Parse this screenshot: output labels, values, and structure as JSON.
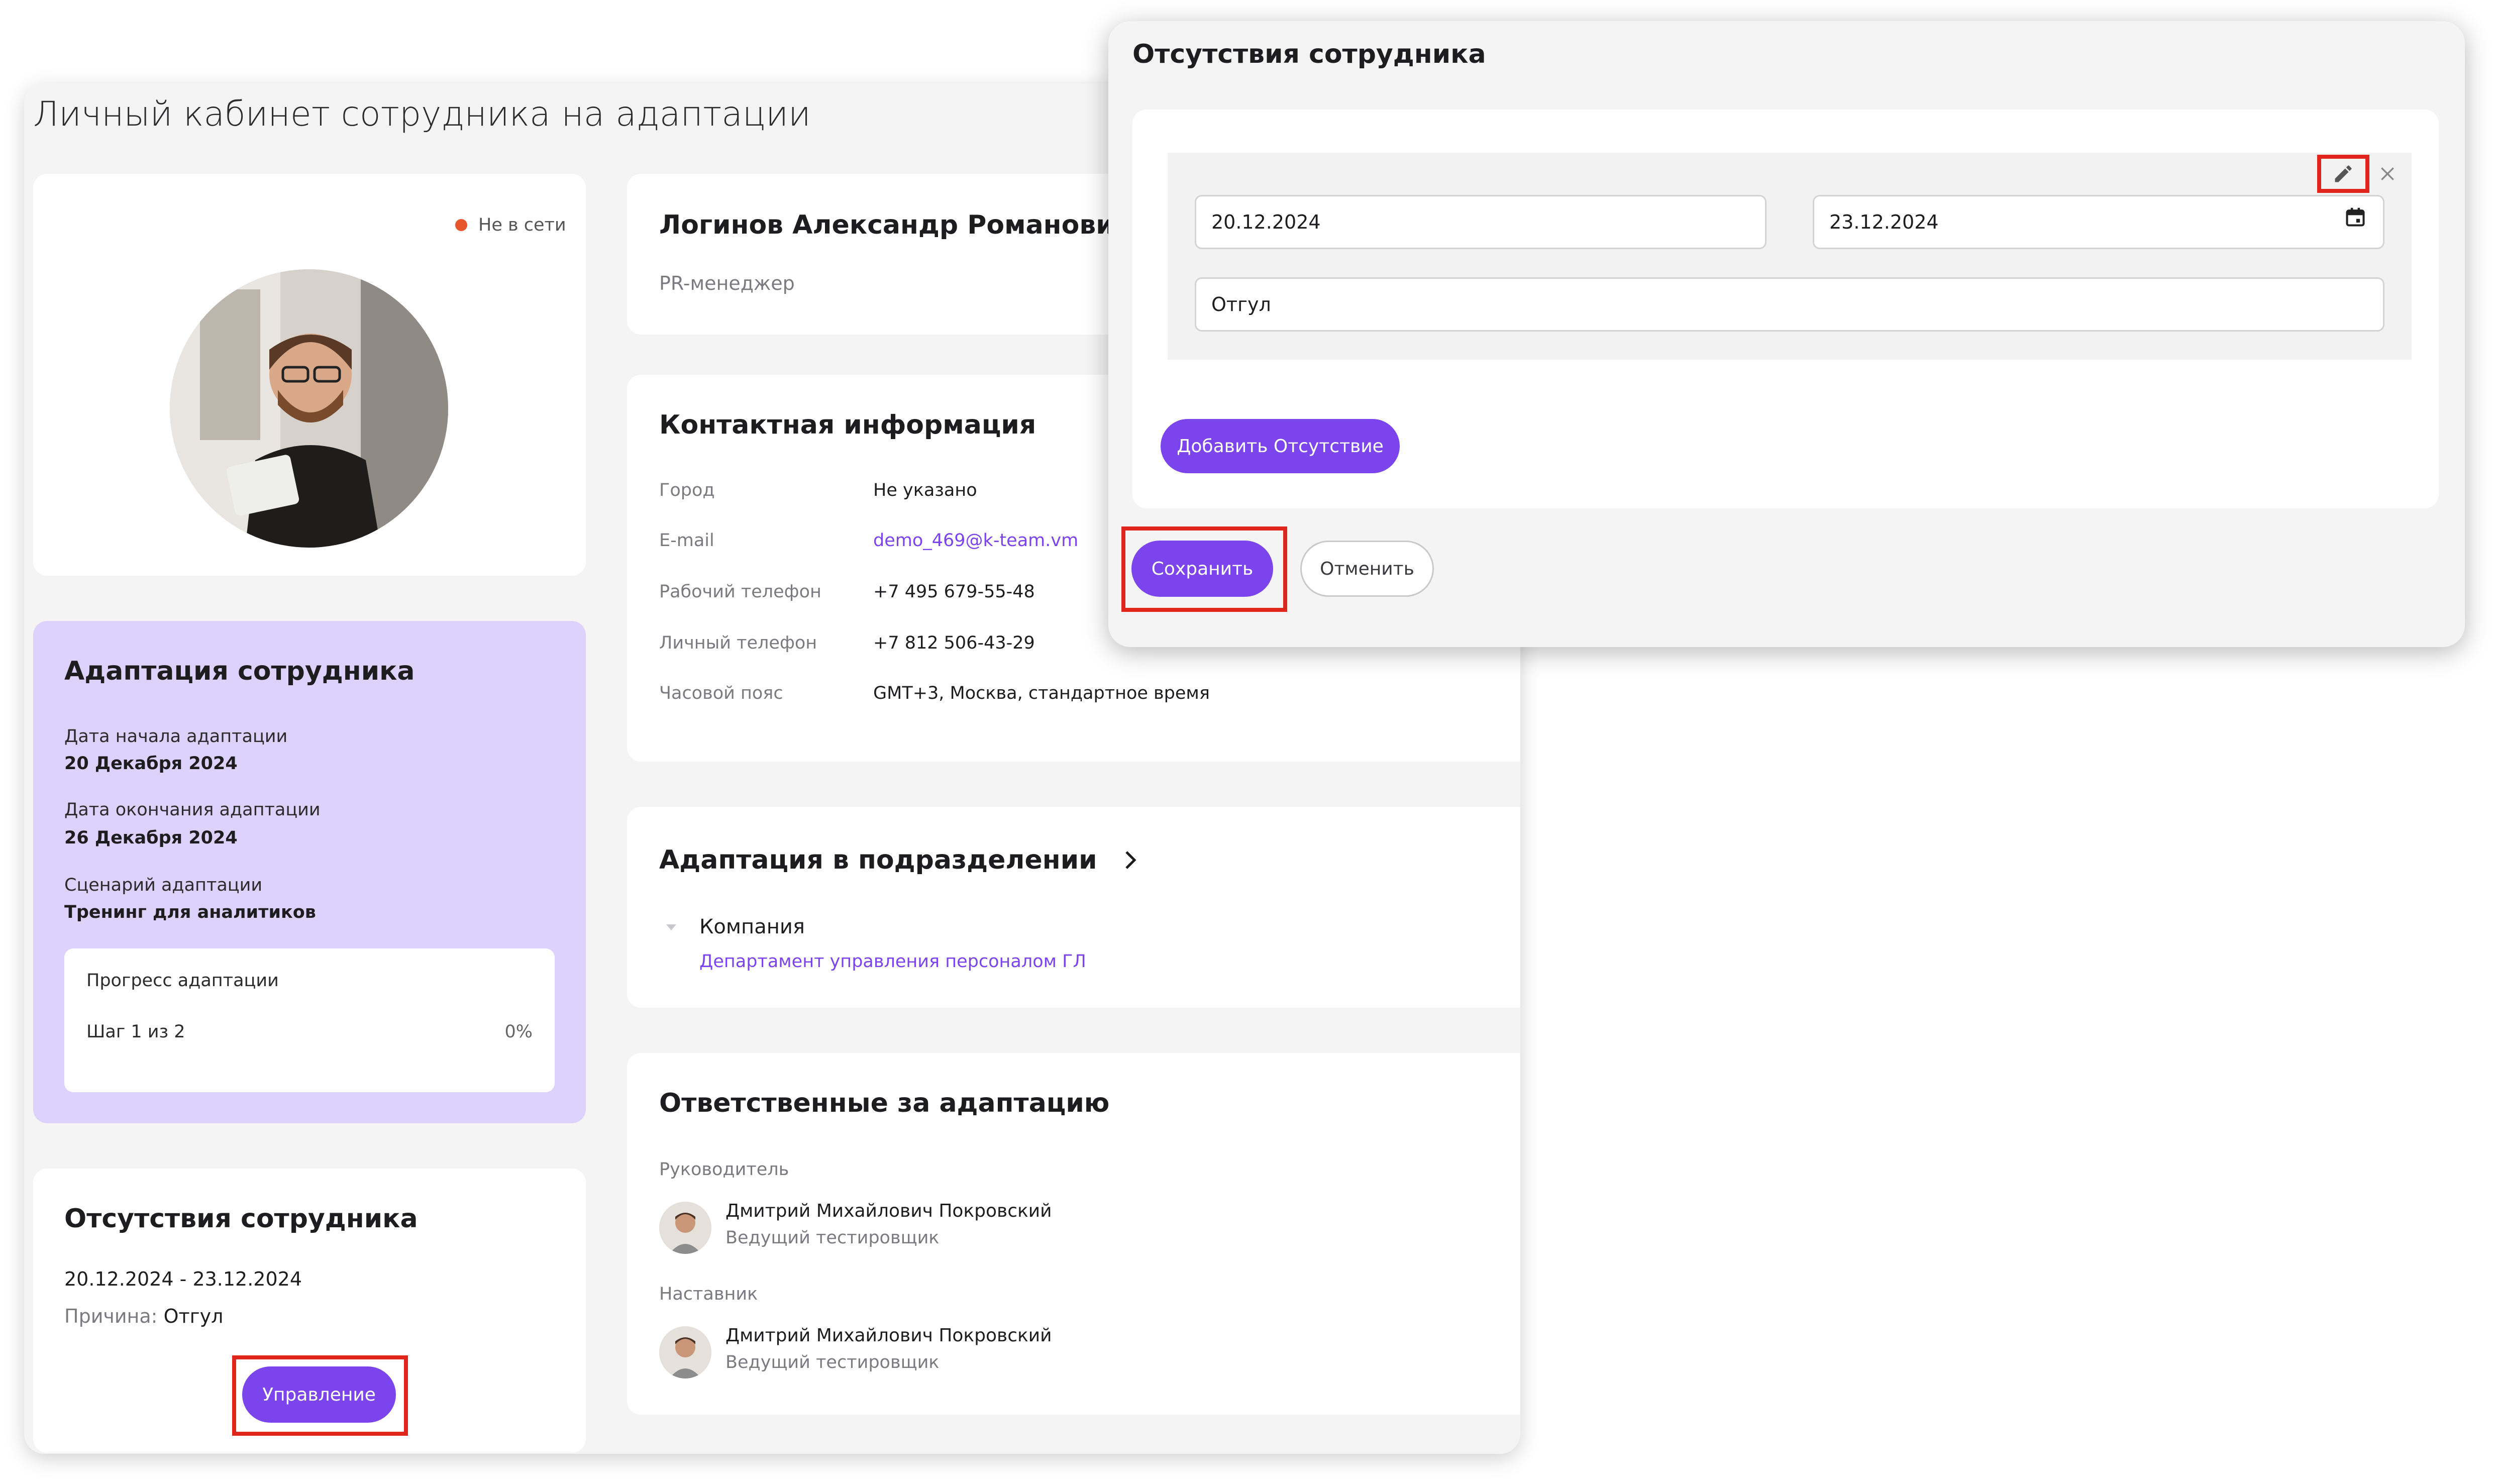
{
  "page": {
    "title": "Личный кабинет сотрудника на адаптации"
  },
  "profile": {
    "status": "Не в сети",
    "name": "Логинов Александр Романович",
    "position": "PR-менеджер"
  },
  "adaptation": {
    "title": "Адаптация сотрудника",
    "start_label": "Дата начала адаптации",
    "start_value": "20 Декабря 2024",
    "end_label": "Дата окончания адаптации",
    "end_value": "26 Декабря 2024",
    "scenario_label": "Сценарий адаптации",
    "scenario_value": "Тренинг для аналитиков",
    "progress": {
      "title": "Прогресс адаптации",
      "step": "Шаг 1 из 2",
      "percent_text": "0%"
    }
  },
  "absences_card": {
    "title": "Отсутствия сотрудника",
    "period": "20.12.2024 - 23.12.2024",
    "reason_label": "Причина:",
    "reason_value": "Отгул",
    "manage_button": "Управление"
  },
  "contact": {
    "title": "Контактная информация",
    "rows": [
      {
        "label": "Город",
        "value": "Не указано"
      },
      {
        "label": "E-mail",
        "value": "demo_469@k-team.vm"
      },
      {
        "label": "Рабочий телефон",
        "value": "+7 495 679-55-48"
      },
      {
        "label": "Личный телефон",
        "value": "+7 812 506-43-29"
      },
      {
        "label": "Часовой пояс",
        "value": "GMT+3, Москва, стандартное время"
      }
    ]
  },
  "department": {
    "title": "Адаптация в подразделении",
    "company": "Компания",
    "department_link": "Департамент управления персоналом ГЛ"
  },
  "responsible": {
    "title": "Ответственные за адаптацию",
    "manager_label": "Руководитель",
    "manager_name": "Дмитрий Михайлович Покровский",
    "manager_role": "Ведущий тестировщик",
    "mentor_label": "Наставник",
    "mentor_name": "Дмитрий Михайлович Покровский",
    "mentor_role": "Ведущий тестировщик"
  },
  "modal": {
    "title": "Отсутствия сотрудника",
    "date_from": "20.12.2024",
    "date_to": "23.12.2024",
    "reason": "Отгул",
    "add_button": "Добавить Отсутствие",
    "save_button": "Сохранить",
    "cancel_button": "Отменить"
  },
  "colors": {
    "accent": "#7b44ec",
    "highlight": "#e0261c",
    "status_offline": "#e8552d",
    "adaptation_bg": "#ddd2fb"
  },
  "icons": {
    "edit": "pencil-icon",
    "remove": "close-icon",
    "calendar": "calendar-icon",
    "expand": "chevron-right-icon",
    "tree": "caret-down-icon"
  }
}
